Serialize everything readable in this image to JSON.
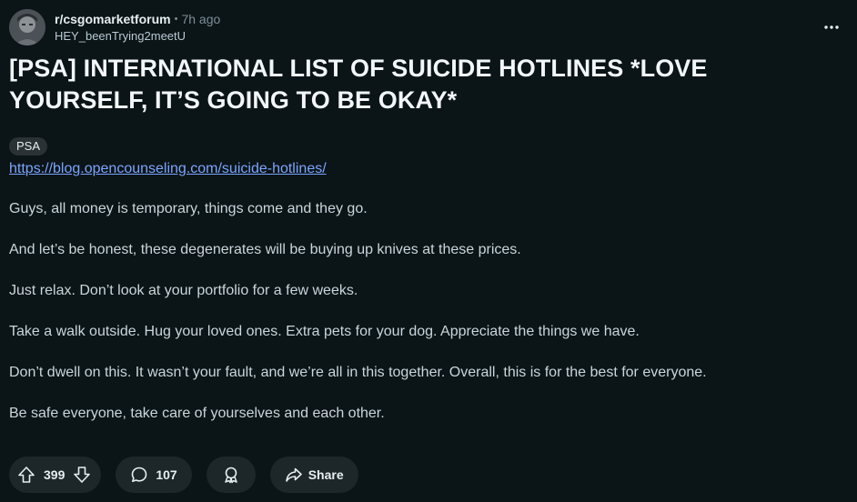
{
  "header": {
    "subreddit": "r/csgomarketforum",
    "separator": "•",
    "time": "7h ago",
    "username": "HEY_beenTrying2meetU",
    "avatar_icon": "user-avatar",
    "more_icon": "more-options-icon"
  },
  "post": {
    "title": "[PSA] INTERNATIONAL LIST OF SUICIDE HOTLINES *LOVE YOURSELF, IT’S GOING TO BE OKAY*",
    "flair": "PSA",
    "link": "https://blog.opencounseling.com/suicide-hotlines/",
    "paragraphs": [
      "Guys, all money is temporary, things come and they go.",
      "And let’s be honest, these degenerates will be buying up knives at these prices.",
      "Just relax. Don’t look at your portfolio for a few weeks.",
      "Take a walk outside. Hug your loved ones. Extra pets for your dog. Appreciate the things we have.",
      "Don’t dwell on this. It wasn’t your fault, and we’re all in this together. Overall, this is for the best for everyone.",
      "Be safe everyone, take care of yourselves and each other."
    ]
  },
  "actions": {
    "vote_count": "399",
    "comment_count": "107",
    "share_label": "Share",
    "upvote_icon": "upvote-arrow-icon",
    "downvote_icon": "downvote-arrow-icon",
    "comment_icon": "comment-bubble-icon",
    "award_icon": "award-icon",
    "share_icon": "share-arrow-icon"
  },
  "colors": {
    "background": "#0b1416",
    "pill": "#1d2629",
    "link": "#7aa6ff",
    "title": "#f2f6f8",
    "muted": "#7c8f99"
  }
}
